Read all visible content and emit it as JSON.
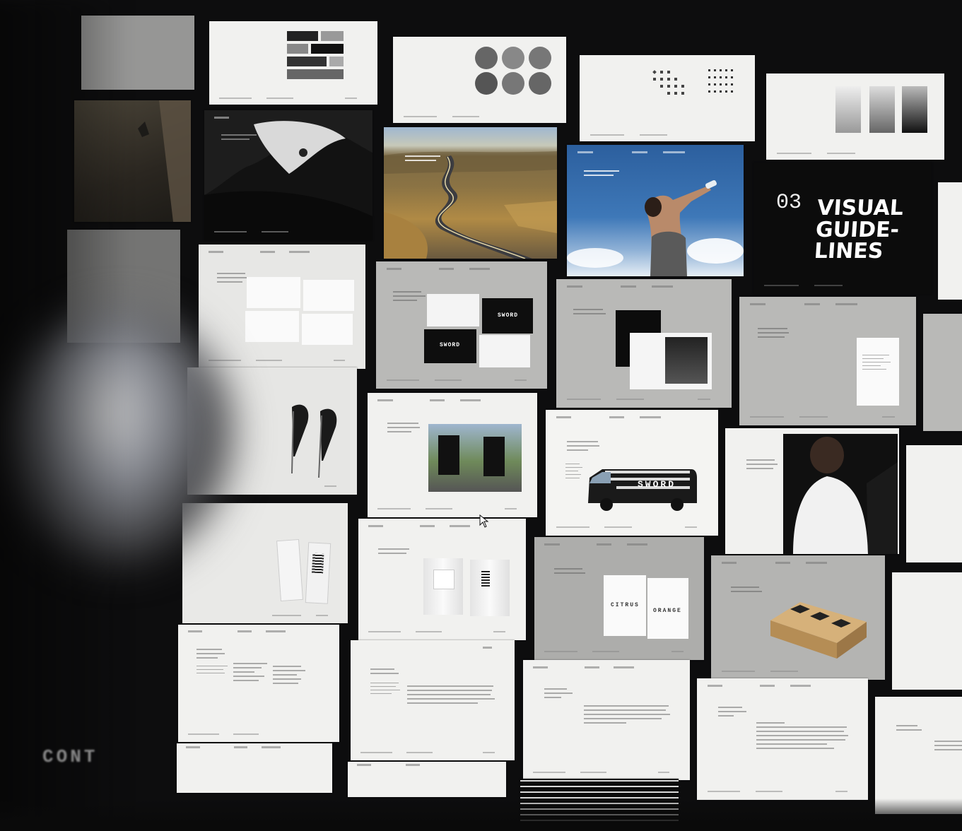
{
  "title_slide": {
    "number": "03",
    "lines": [
      "VISUAL",
      "GUIDE-",
      "LINES"
    ]
  },
  "brand": {
    "wordmark": "SWORD"
  },
  "packaging_labels": [
    "CITRUS",
    "ORANGE"
  ],
  "partial_heading": "CONT",
  "colors": {
    "slide_white": "#f1f1ef",
    "slide_grey": "#b9b9b7",
    "slide_dark": "#0c0c0c",
    "background": "#0d0d0e"
  },
  "icons": [
    "cursor-arrow-icon"
  ]
}
